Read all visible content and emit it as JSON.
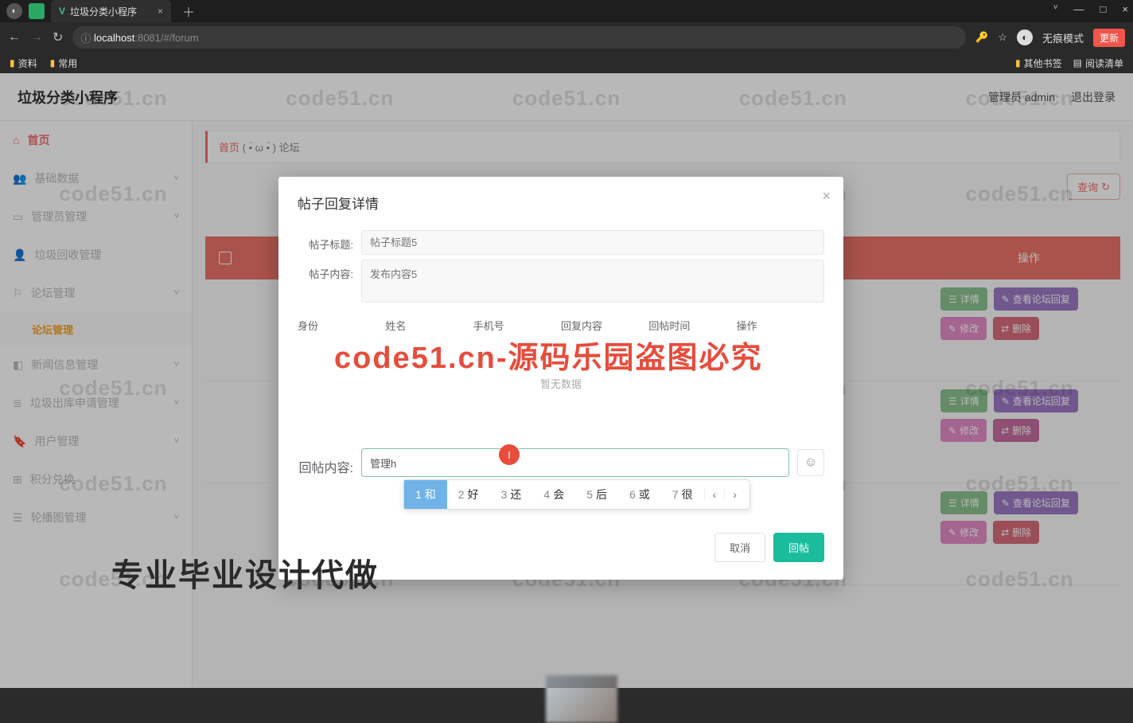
{
  "browser": {
    "tab_title": "垃圾分类小程序",
    "minimize": "—",
    "maximize": "□",
    "close": "×",
    "dropdown": "˅",
    "url": {
      "info": "ⓘ",
      "host": "localhost",
      "port": ":8081",
      "path": "/#/forum"
    },
    "back": "←",
    "forward": "→",
    "reload": "↻",
    "key_icon": "🔑",
    "star_icon": "☆",
    "incognito_label": "无痕模式",
    "update_label": "更新",
    "bookmarks": {
      "b1": "资料",
      "b2": "常用",
      "other": "其他书签",
      "readinglist": "阅读清单",
      "rl_icon": "▤"
    }
  },
  "header": {
    "app_title": "垃圾分类小程序",
    "admin": "管理员 admin",
    "logout": "退出登录"
  },
  "breadcrumb": {
    "home": "首页",
    "face": "( •̀ ω •́ )",
    "current": "论坛"
  },
  "sidebar": {
    "items": [
      {
        "icon": "⌂",
        "label": "首页"
      },
      {
        "icon": "👥",
        "label": "基础数据",
        "chev": "˅"
      },
      {
        "icon": "▭",
        "label": "管理员管理",
        "chev": "˅"
      },
      {
        "icon": "👤",
        "label": "垃圾回收管理"
      },
      {
        "icon": "⚐",
        "label": "论坛管理",
        "chev": "˅"
      },
      {
        "icon": null,
        "label": "论坛管理",
        "sub": true
      },
      {
        "icon": "◧",
        "label": "新闻信息管理",
        "chev": "˅"
      },
      {
        "icon": "≣",
        "label": "垃圾出库申请管理",
        "chev": "˅"
      },
      {
        "icon": "🔖",
        "label": "用户管理",
        "chev": "˅"
      },
      {
        "icon": "⊞",
        "label": "积分兑换"
      },
      {
        "icon": "☰",
        "label": "轮播图管理",
        "chev": "˅"
      }
    ]
  },
  "toolbar": {
    "query": "查询",
    "query_icon": "↻"
  },
  "table": {
    "checkbox": "",
    "ops_header": "操作"
  },
  "ops": {
    "detail": "详情",
    "viewreply": "查看论坛回复",
    "edit": "修改",
    "delete": "删除",
    "iconlist": "☰",
    "iconpen": "✎",
    "iconswap": "⇄"
  },
  "modal": {
    "title": "帖子回复详情",
    "close": "×",
    "f_title_label": "帖子标题:",
    "f_title_placeholder": "帖子标题5",
    "f_content_label": "帖子内容:",
    "f_content_placeholder": "发布内容5",
    "cols": {
      "c1": "身份",
      "c2": "姓名",
      "c3": "手机号",
      "c4": "回复内容",
      "c5": "回帖时间",
      "c6": "操作"
    },
    "empty": "暂无数据",
    "reply_label": "回帖内容:",
    "reply_value": "管理h",
    "cursor_mark": "I",
    "emoji": "☺",
    "ime": {
      "c1n": "1",
      "c1": "和",
      "c2n": "2",
      "c2": "好",
      "c3n": "3",
      "c3": "还",
      "c4n": "4",
      "c4": "会",
      "c5n": "5",
      "c5": "后",
      "c6n": "6",
      "c6": "或",
      "c7n": "7",
      "c7": "很",
      "prev": "‹",
      "next": "›"
    },
    "cancel": "取消",
    "submit": "回帖"
  },
  "watermark": {
    "grey": "code51.cn",
    "red": "code51.cn-源码乐园盗图必究",
    "black": "专业毕业设计代做"
  }
}
